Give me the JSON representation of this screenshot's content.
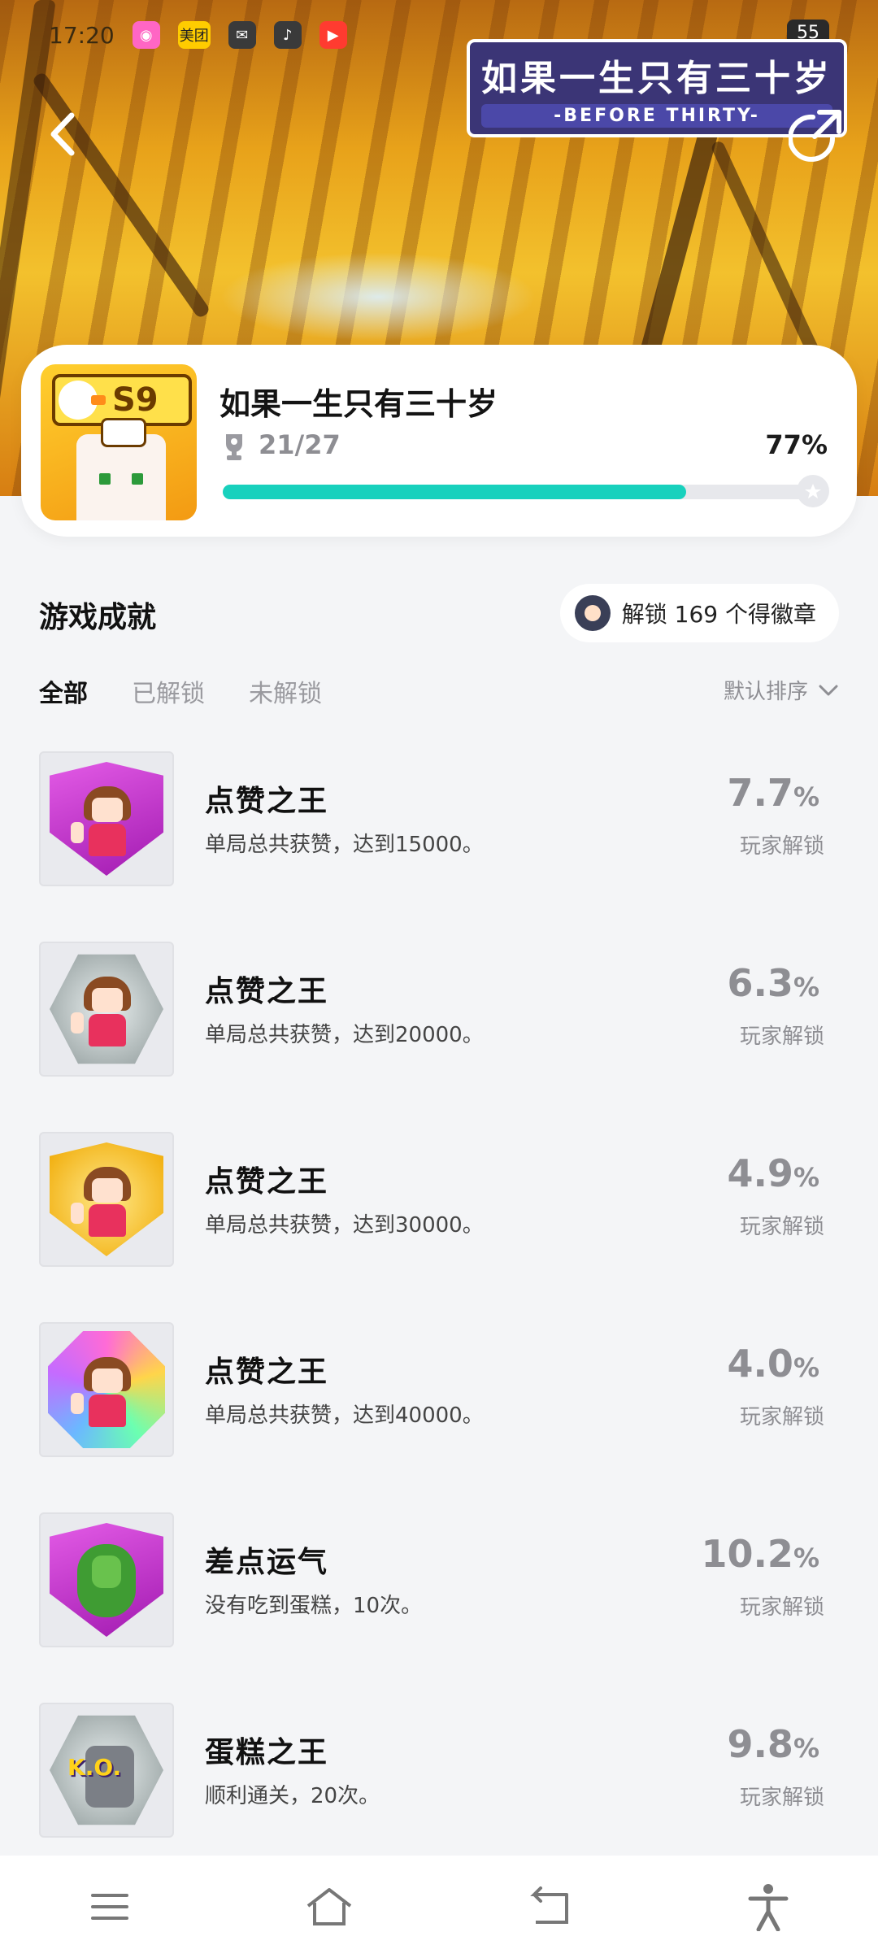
{
  "status_bar": {
    "time": "17:20",
    "apps": [
      "meituan-app",
      "wechat-app",
      "music-app",
      "video-app"
    ],
    "meituan_label": "美团",
    "battery": "55"
  },
  "banner": {
    "logo_title": "如果一生只有三十岁",
    "logo_subtitle": "-BEFORE THIRTY-"
  },
  "game": {
    "title": "如果一生只有三十岁",
    "season_tag": "S9",
    "progress_text": "21/27",
    "percent_text": "77%",
    "progress_fraction": 0.77,
    "accent_color": "#18d1bd"
  },
  "section": {
    "title": "游戏成就",
    "badge_text": "解锁 169 个得徽章"
  },
  "tabs": [
    {
      "label": "全部",
      "active": true
    },
    {
      "label": "已解锁",
      "active": false
    },
    {
      "label": "未解锁",
      "active": false
    }
  ],
  "sort_label": "默认排序",
  "achievements": [
    {
      "name": "点赞之王",
      "desc": "单局总共获赞，达到15000。",
      "rate": "7.7",
      "unit": "%",
      "label": "玩家解锁",
      "badge": "purple-shield",
      "color": "#c234c9"
    },
    {
      "name": "点赞之王",
      "desc": "单局总共获赞，达到20000。",
      "rate": "6.3",
      "unit": "%",
      "label": "玩家解锁",
      "badge": "silver-hexagon",
      "color": "#9aa3a3"
    },
    {
      "name": "点赞之王",
      "desc": "单局总共获赞，达到30000。",
      "rate": "4.9",
      "unit": "%",
      "label": "玩家解锁",
      "badge": "gold-shield",
      "color": "#f2b818"
    },
    {
      "name": "点赞之王",
      "desc": "单局总共获赞，达到40000。",
      "rate": "4.0",
      "unit": "%",
      "label": "玩家解锁",
      "badge": "rainbow-octagon",
      "color": "#e86bd6"
    },
    {
      "name": "差点运气",
      "desc": "没有吃到蛋糕，10次。",
      "rate": "10.2",
      "unit": "%",
      "label": "玩家解锁",
      "badge": "purple-shield-turtle",
      "color": "#c234c9"
    },
    {
      "name": "蛋糕之王",
      "desc": "顺利通关，20次。",
      "rate": "9.8",
      "unit": "%",
      "label": "玩家解锁",
      "badge": "silver-hexagon-ko",
      "color": "#9aa3a3"
    }
  ],
  "nav": [
    "menu-icon",
    "home-icon",
    "back-icon",
    "accessibility-icon"
  ]
}
